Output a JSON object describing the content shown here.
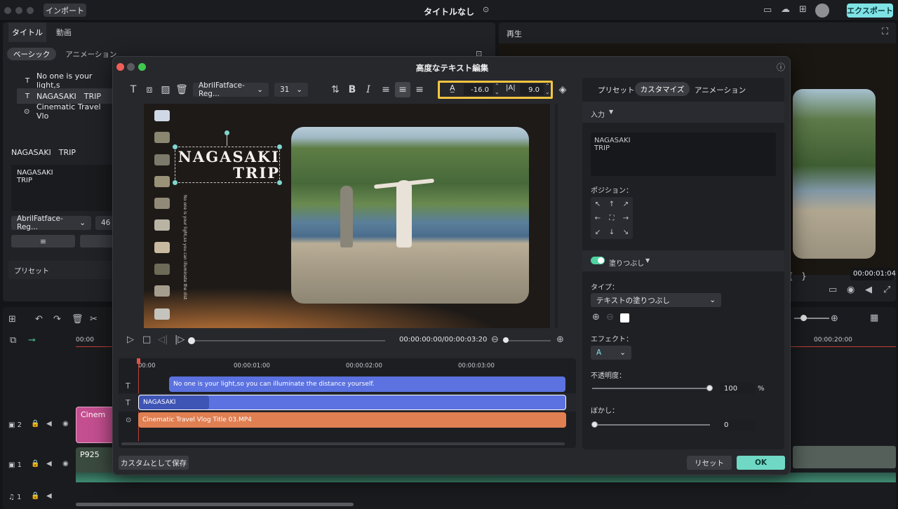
{
  "app": {
    "title": "タイトルなし",
    "import_label": "インポート",
    "export_label": "エクスポート"
  },
  "left_panel": {
    "tabs": [
      "タイトル",
      "動画"
    ],
    "subtabs": [
      "ベーシック",
      "アニメーション"
    ],
    "text_items": [
      "No one is your light,s",
      "NAGASAKI　TRIP",
      "Cinematic Travel Vlo"
    ],
    "section_title": "NAGASAKI　TRIP",
    "text_value_line1": "NAGASAKI",
    "text_value_line2": "TRIP",
    "font_name": "AbrilFatface-Reg...",
    "font_size": "46",
    "preset_label": "プリセット"
  },
  "preview_panel": {
    "title": "再生",
    "timecode": "00:00:01:04"
  },
  "timeline": {
    "ruler_start": "00:00",
    "ruler_mark": "00:00:20:00",
    "track_2_clip": "Cinem",
    "track_1_clip": "P925",
    "track_labels": [
      "2",
      "1",
      "1"
    ]
  },
  "modal": {
    "title": "高度なテキスト編集",
    "toolbar": {
      "font_name": "AbrilFatface-Reg...",
      "font_size": "31",
      "char_spacing": "-16.0",
      "line_spacing": "9.0"
    },
    "canvas": {
      "title_line1": "NAGASAKI",
      "title_line2": "TRIP",
      "vertical_text": "No one is your light,so you can illuminate the distance yourself."
    },
    "playback": {
      "timecode": "00:00:00:00/00:00:03:20"
    },
    "mini_timeline": {
      "ruler": [
        "00:00",
        "00:00:01:00",
        "00:00:02:00",
        "00:00:03:00"
      ],
      "clips": {
        "subtitle": "No one is your light,so you can illuminate the distance yourself.",
        "title": "NAGASAKI",
        "video": "Cinematic Travel Vlog Title 03.MP4"
      }
    },
    "props": {
      "tabs": [
        "プリセット",
        "カスタマイズ",
        "アニメーション"
      ],
      "input_label": "入力",
      "input_line1": "NAGASAKI",
      "input_line2": "TRIP",
      "position_label": "ポジション：",
      "fill_label": "塗りつぶし",
      "type_label": "タイプ：",
      "type_value": "テキストの塗りつぶし",
      "effect_label": "エフェクト：",
      "effect_glyph": "A",
      "opacity_label": "不透明度：",
      "opacity_value": "100",
      "opacity_unit": "%",
      "blur_label": "ぼかし：",
      "blur_value": "0"
    },
    "footer": {
      "save_custom": "カスタムとして保存",
      "reset": "リセット",
      "ok": "OK"
    }
  },
  "colors": {
    "accent": "#7fe3e6",
    "highlight": "#f5c542",
    "ok_button": "#6fd9c5",
    "clip_blue": "#5b72e0",
    "clip_orange": "#e07f52",
    "clip_pink": "#d65fa0"
  }
}
